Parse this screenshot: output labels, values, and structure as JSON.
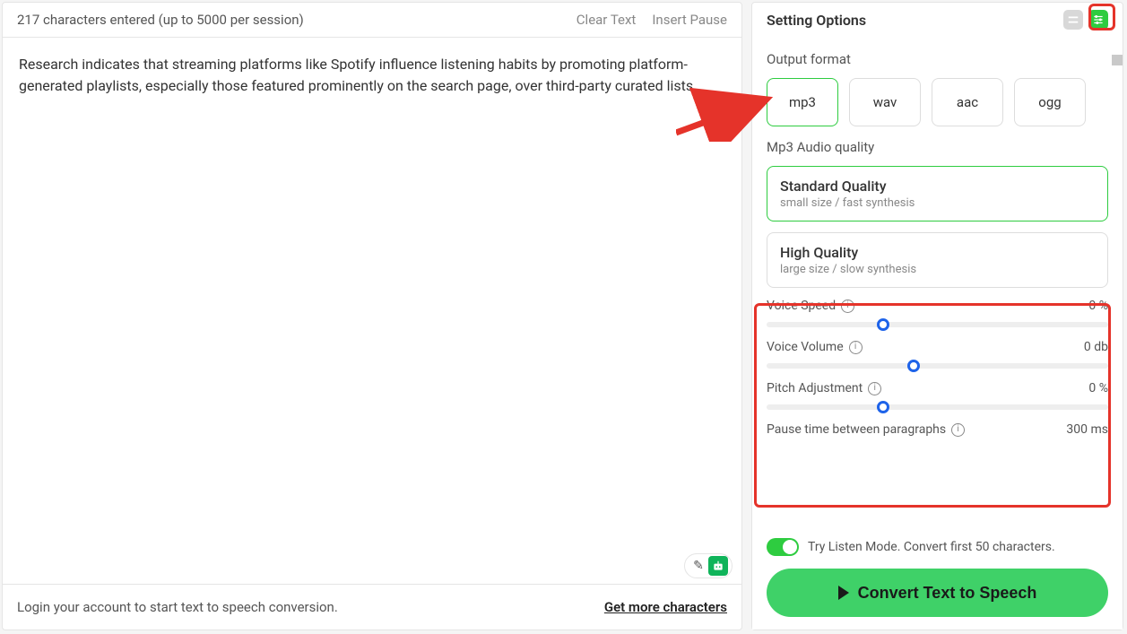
{
  "left": {
    "charCount": "217 characters entered (up to 5000 per session)",
    "clearText": "Clear Text",
    "insertPause": "Insert Pause",
    "content": "Research indicates that streaming platforms like Spotify influence listening habits by promoting platform-generated playlists, especially those featured prominently on the search page, over third-party curated lists.",
    "loginPrompt": "Login your account to start text to speech conversion.",
    "getMore": "Get more characters"
  },
  "right": {
    "title": "Setting Options",
    "outputFormatLabel": "Output format",
    "formats": {
      "mp3": "mp3",
      "wav": "wav",
      "aac": "aac",
      "ogg": "ogg"
    },
    "qualityLabel": "Mp3 Audio quality",
    "quality": {
      "standardTitle": "Standard Quality",
      "standardSub": "small size / fast synthesis",
      "highTitle": "High Quality",
      "highSub": "large size / slow synthesis"
    },
    "sliders": {
      "speedLabel": "Voice Speed",
      "speedValue": "0 %",
      "volumeLabel": "Voice Volume",
      "volumeValue": "0 db",
      "pitchLabel": "Pitch Adjustment",
      "pitchValue": "0 %",
      "pauseLabel": "Pause time between paragraphs",
      "pauseValue": "300 ms"
    },
    "listenMode": "Try Listen Mode. Convert first 50 characters.",
    "convert": "Convert Text to Speech"
  }
}
